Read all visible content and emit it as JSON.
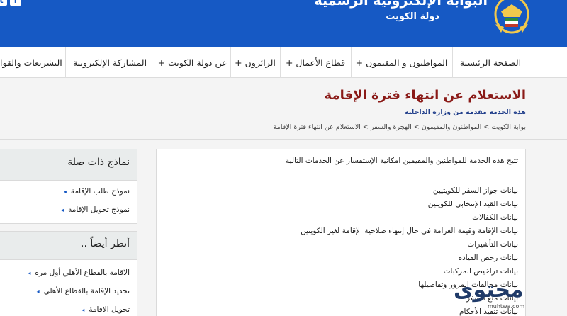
{
  "header": {
    "portal_title": "البوابة الإلكترونية الرسمية",
    "portal_subtitle": "دولة  الكويت",
    "social": [
      {
        "icon": "twitter-icon",
        "glyph": "t"
      },
      {
        "icon": "facebook-icon",
        "glyph": "f"
      }
    ],
    "brand_color": "#1659c4"
  },
  "nav": {
    "items": [
      {
        "label": "الصفحة الرئيسية"
      },
      {
        "label": "المواطنون و المقيمون +"
      },
      {
        "label": "قطاع الأعمال +"
      },
      {
        "label": "الزائرون +"
      },
      {
        "label": "عن دولة الكويت +"
      },
      {
        "label": "المشاركة الإلكترونية"
      },
      {
        "label": "التشريعات والقوا"
      }
    ]
  },
  "page": {
    "title": "الاستعلام عن انتهاء فترة الإقامة",
    "subtitle": "هذه الخدمة مقدمة من وزارة الداخلية",
    "breadcrumb": "بوابة الكويت > المواطنون والمقيمون > الهجرة والسفر > الاستعلام عن انتهاء فترة الإقامة",
    "title_color": "#8a1a17"
  },
  "content": {
    "intro": "تتيح هذه الخدمة للمواطنين والمقيمين امكانية الإستفسار عن الخدمات التالية",
    "services": [
      "بيانات جواز السفر للكويتيين",
      "بيانات القيد الإنتخابي للكويتين",
      "بيانات الكفالات",
      "بيانات الإقامة وقيمة الغرامة في حال إنتهاء صلاحية الإقامة لغير الكويتين",
      "بيانات التأشيرات",
      "بيانات رخص القيادة",
      "بيانات تراخيص المركبات",
      "بيانات مخالفات المرور وتفاصيلها",
      "بيانات منع السفر",
      "بيانات تنفيذ الأحكام"
    ]
  },
  "sidebar": {
    "related_forms": {
      "title": "نماذج ذات صلة",
      "links": [
        "نموذج طلب الإقامة",
        "نموذج تحويل الإقامة"
      ]
    },
    "see_also": {
      "title": "أنظر أيضاً ..",
      "links": [
        "الاقامة بالقطاع الأهلي أول مرة",
        "تجديد الإقامة بالقطاع الأهلي",
        "تحويل الاقامة"
      ]
    }
  },
  "watermark": {
    "brand": "محتوى",
    "url": "muhtwa.com"
  }
}
